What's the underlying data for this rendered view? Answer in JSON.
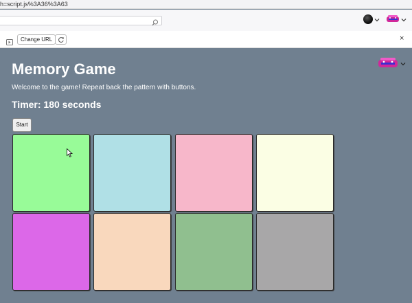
{
  "url_fragment": "h=script.js%3A36%3A63",
  "toolbar": {
    "change_url_label": "Change URL",
    "close_label": "×"
  },
  "game": {
    "title": "Memory Game",
    "welcome": "Welcome to the game! Repeat back the pattern with buttons.",
    "timer": "Timer: 180 seconds",
    "start_label": "Start"
  },
  "tiles": [
    {
      "color": "#98fb98"
    },
    {
      "color": "#b0e0e6"
    },
    {
      "color": "#f7b7ca"
    },
    {
      "color": "#fbfee4"
    },
    {
      "color": "#dc68e8"
    },
    {
      "color": "#f9d8bd"
    },
    {
      "color": "#90bf8f"
    },
    {
      "color": "#a8a7a8"
    }
  ],
  "colors": {
    "page_bg": "#708090"
  }
}
